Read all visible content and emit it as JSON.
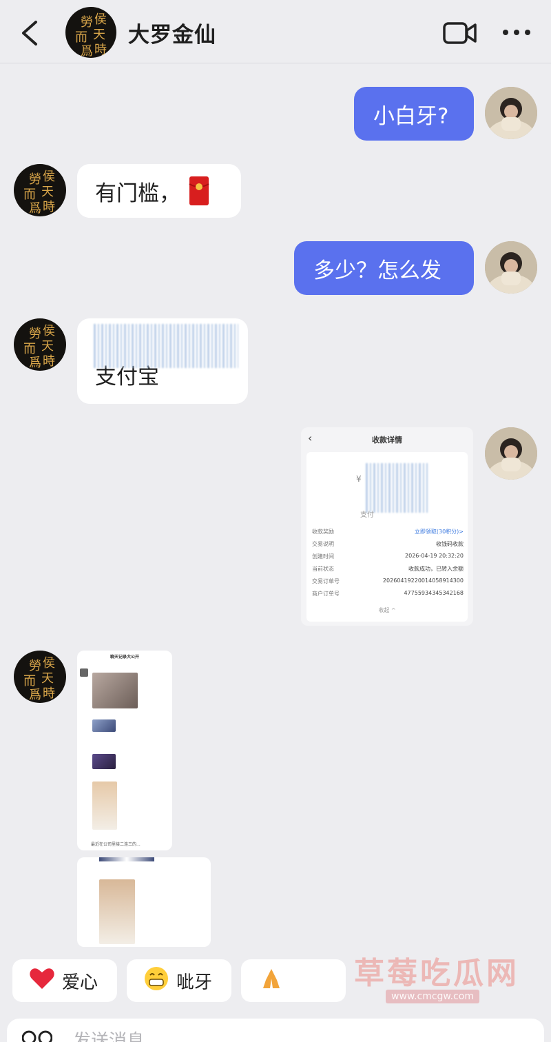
{
  "header": {
    "title": "大罗金仙",
    "avatar_text": [
      "侯",
      "天",
      "時",
      "勞",
      "而",
      "爲"
    ]
  },
  "messages": [
    {
      "from": "self",
      "text": "小白牙?"
    },
    {
      "from": "other",
      "text": "有门槛，"
    },
    {
      "from": "self",
      "text": "多少？怎么发"
    },
    {
      "from": "other",
      "text": "支付宝"
    }
  ],
  "receipt": {
    "title": "收款详情",
    "amount_prefix": "¥",
    "amount_label": "支付",
    "rows": [
      {
        "label": "收款奖励",
        "value": "立即领取(30积分)>"
      },
      {
        "label": "交易说明",
        "value": "收钱码收款"
      },
      {
        "label": "创建时间",
        "value": "2026-04-19 20:32:20"
      },
      {
        "label": "当前状态",
        "value": "收款成功，已转入余额"
      },
      {
        "label": "交易订单号",
        "value": "20260419220014058914300"
      },
      {
        "label": "商户订单号",
        "value": "47755934345342168"
      }
    ],
    "footer": "收起 ^"
  },
  "shot1": {
    "title": "聊天记录大公开",
    "caption": "最近在公司里接二连三的..."
  },
  "quick_replies": [
    {
      "icon": "heart-emoji",
      "label": "爱心"
    },
    {
      "icon": "grin-emoji",
      "label": "呲牙"
    },
    {
      "icon": "pray-emoji",
      "label": ""
    }
  ],
  "watermark": {
    "text": "草莓吃瓜网",
    "url": "www.cmcgw.com"
  },
  "input": {
    "placeholder": "发送消息"
  },
  "colors": {
    "self_bubble": "#5a71ee",
    "background": "#ededf0"
  }
}
